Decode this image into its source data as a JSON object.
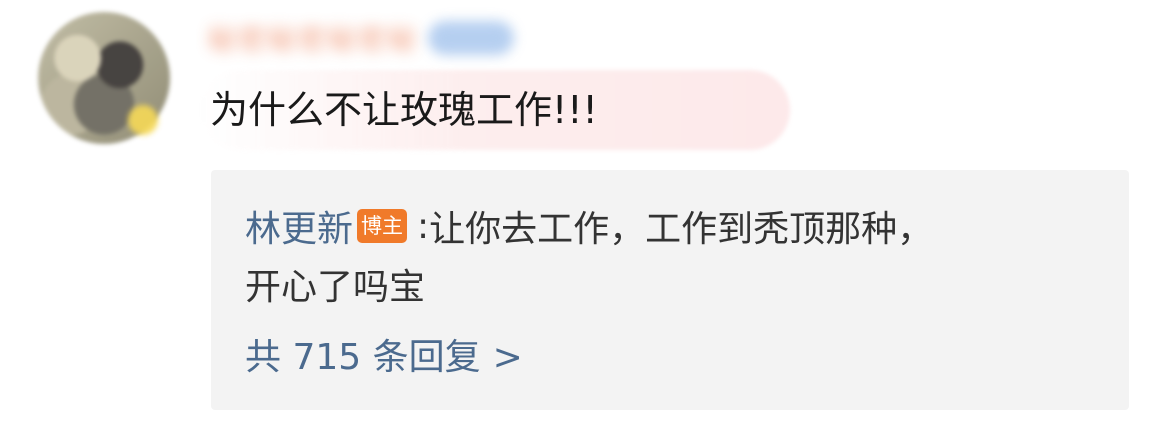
{
  "comment": {
    "username": "秘密秘密秘密秘",
    "text": "为什么不让玫瑰工作!!!"
  },
  "reply": {
    "author": "林更新",
    "author_badge": "博主",
    "separator": ":",
    "text_line1": "让你去工作，工作到秃顶那种，",
    "text_line2": "开心了吗宝",
    "count_label": "共 715 条回复",
    "chevron": ">"
  },
  "colors": {
    "link_blue": "#4b6a8e",
    "badge_orange": "#f07a2a",
    "reply_bg": "#f3f3f3",
    "text": "#1a1a1a"
  },
  "icons": {
    "avatar": "user-avatar",
    "chevron": "chevron-right-icon"
  }
}
